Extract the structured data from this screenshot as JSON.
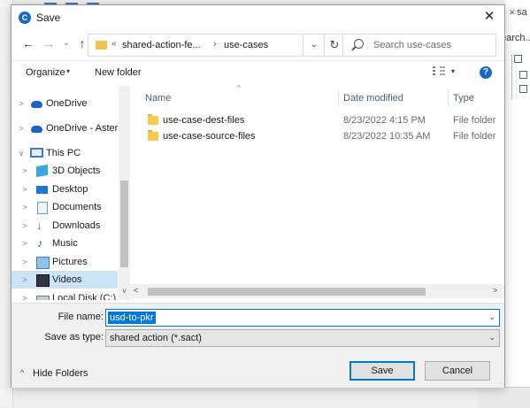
{
  "dialog": {
    "title": "Save",
    "close_symbol": "✕"
  },
  "background": {
    "right_text": "earch...",
    "right_text_top": "sa"
  },
  "nav": {
    "back": "←",
    "forward": "→",
    "dropdown": "⌄",
    "up": "↑"
  },
  "address": {
    "chevron": "«",
    "segments": [
      "shared-action-fe...",
      "use-cases"
    ],
    "separator": "›",
    "dropdown": "⌄",
    "refresh": "↻"
  },
  "search": {
    "placeholder": "Search use-cases"
  },
  "toolbar": {
    "organize_label": "Organize",
    "organize_caret": "▾",
    "new_folder_label": "New folder",
    "view_caret": "▾",
    "help_symbol": "?"
  },
  "sidebar": {
    "items": [
      {
        "label": "OneDrive",
        "expander": ">"
      },
      {
        "label": "OneDrive - Astera",
        "expander": ">"
      },
      {
        "label": "This PC",
        "expander": "v"
      },
      {
        "label": "3D Objects",
        "expander": ">"
      },
      {
        "label": "Desktop",
        "expander": ">"
      },
      {
        "label": "Documents",
        "expander": ">"
      },
      {
        "label": "Downloads",
        "expander": ">"
      },
      {
        "label": "Music",
        "expander": ">"
      },
      {
        "label": "Pictures",
        "expander": ">"
      },
      {
        "label": "Videos",
        "expander": ">"
      },
      {
        "label": "Local Disk (C:)",
        "expander": ">"
      }
    ],
    "scroll_down": "v"
  },
  "file_list": {
    "sort_indicator": "^",
    "columns": {
      "name": "Name",
      "date": "Date modified",
      "type": "Type"
    },
    "rows": [
      {
        "name": "use-case-dest-files",
        "date": "8/23/2022 4:15 PM",
        "type": "File folder"
      },
      {
        "name": "use-case-source-files",
        "date": "8/23/2022 10:35 AM",
        "type": "File folder"
      }
    ],
    "scroll_left": "<",
    "scroll_right": ">"
  },
  "form": {
    "file_name_label": "File name:",
    "file_name_value": "usd-to-pkr",
    "save_type_label": "Save as type:",
    "save_type_value": "shared action (*.sact)",
    "caret": "⌄",
    "hide_folders_caret": "^",
    "hide_folders_label": "Hide Folders",
    "save_label": "Save",
    "cancel_label": "Cancel"
  }
}
